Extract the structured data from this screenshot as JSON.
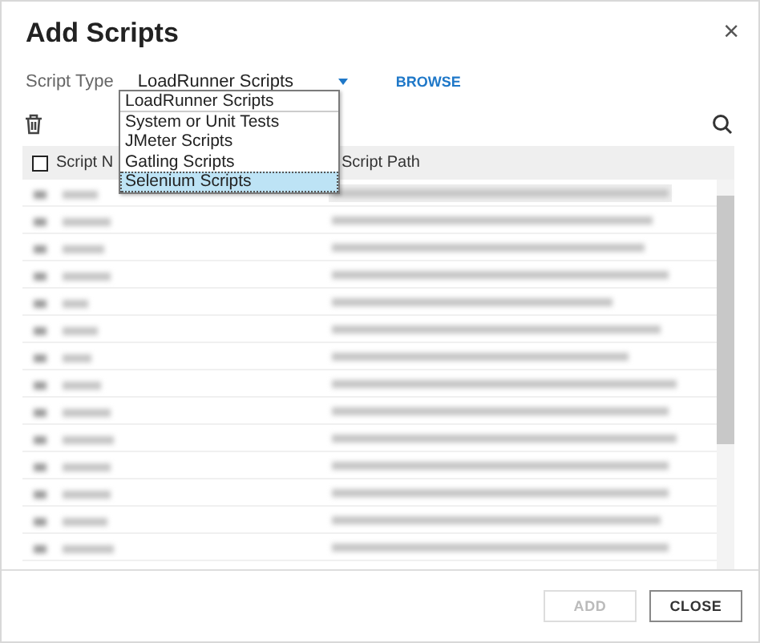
{
  "dialog": {
    "title": "Add Scripts",
    "close": "×"
  },
  "script_type": {
    "label": "Script Type",
    "value": "LoadRunner Scripts",
    "browse": "BROWSE"
  },
  "dropdown": {
    "options": [
      {
        "label": "LoadRunner Scripts",
        "selected": false
      },
      {
        "label": "System or Unit Tests",
        "selected": false
      },
      {
        "label": "JMeter Scripts",
        "selected": false
      },
      {
        "label": "Gatling Scripts",
        "selected": false
      },
      {
        "label": "Selenium Scripts",
        "selected": true
      }
    ]
  },
  "table": {
    "select_all": {
      "checked": false
    },
    "columns": [
      "Script N",
      "Script Path"
    ],
    "rows": [
      {
        "kind": "blurred",
        "selected": true
      },
      {
        "kind": "blurred",
        "selected": false
      },
      {
        "kind": "blurred",
        "selected": false
      },
      {
        "kind": "blurred",
        "selected": false
      },
      {
        "kind": "blurred",
        "selected": false
      },
      {
        "kind": "blurred",
        "selected": false
      },
      {
        "kind": "blurred",
        "selected": false
      },
      {
        "kind": "blurred",
        "selected": false
      },
      {
        "kind": "blurred",
        "selected": false
      },
      {
        "kind": "blurred",
        "selected": false
      },
      {
        "kind": "blurred",
        "selected": false
      },
      {
        "kind": "blurred",
        "selected": false
      },
      {
        "kind": "blurred",
        "selected": false
      },
      {
        "kind": "blurred",
        "selected": false
      }
    ]
  },
  "buttons": [
    {
      "label": "ADD",
      "disabled": true
    },
    {
      "label": "CLOSE",
      "disabled": false
    }
  ]
}
